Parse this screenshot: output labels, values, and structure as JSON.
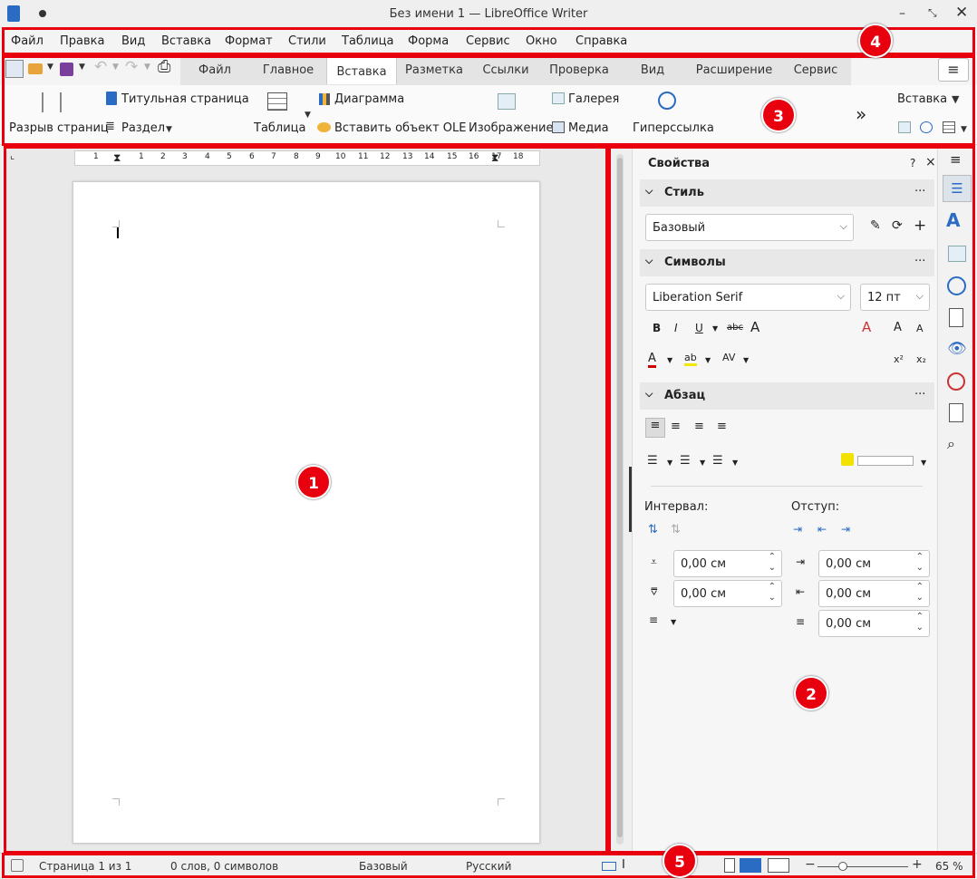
{
  "window": {
    "title": "Без имени 1 — LibreOffice Writer"
  },
  "menu": [
    "Файл",
    "Правка",
    "Вид",
    "Вставка",
    "Формат",
    "Стили",
    "Таблица",
    "Форма",
    "Сервис",
    "Окно",
    "Справка"
  ],
  "tabs": [
    "Файл",
    "Главное",
    "Вставка",
    "Разметка",
    "Ссылки",
    "Проверка",
    "Вид",
    "Расширение",
    "Сервис"
  ],
  "active_tab": "Вставка",
  "ribbon": {
    "page_break": "Разрыв страниц",
    "title_page": "Титульная страница",
    "section": "Раздел",
    "table": "Таблица",
    "chart": "Диаграмма",
    "ole": "Вставить объект OLE",
    "image": "Изображение",
    "gallery": "Галерея",
    "media": "Медиа",
    "hyperlink": "Гиперссылка",
    "more": "»",
    "insert_dropdown": "Вставка"
  },
  "ruler": {
    "ticks": [
      "1",
      "1",
      "2",
      "3",
      "4",
      "5",
      "6",
      "7",
      "8",
      "9",
      "10",
      "11",
      "12",
      "13",
      "14",
      "15",
      "16",
      "17",
      "18"
    ]
  },
  "sidebar": {
    "title": "Свойства",
    "help": "?",
    "close": "×",
    "style_section": "Стиль",
    "style_value": "Базовый",
    "chars_section": "Символы",
    "font_name": "Liberation Serif",
    "font_size": "12 пт",
    "para_section": "Абзац",
    "spacing_label": "Интервал:",
    "indent_label": "Отступ:",
    "above": "0,00 см",
    "below": "0,00 см",
    "indent_before": "0,00 см",
    "indent_after": "0,00 см",
    "first_line": "0,00 см",
    "more": "···"
  },
  "status": {
    "page": "Страница 1 из 1",
    "words": "0 слов, 0 символов",
    "style": "Базовый",
    "language": "Русский",
    "zoom": "65 %"
  },
  "badges": [
    "1",
    "2",
    "3",
    "4",
    "5"
  ],
  "colors": {
    "accent": "#e0483d",
    "annotation": "#e8000f",
    "writer_blue": "#2a6bc4"
  }
}
